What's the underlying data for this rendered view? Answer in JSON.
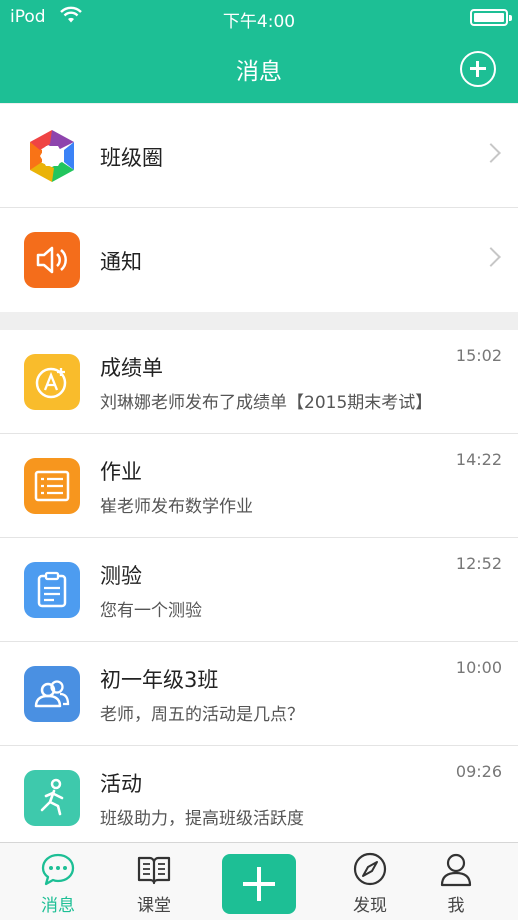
{
  "status_bar": {
    "carrier": "iPod",
    "time": "下午4:00"
  },
  "nav": {
    "title": "消息"
  },
  "pinned": [
    {
      "title": "班级圈",
      "icon": "aperture-icon"
    },
    {
      "title": "通知",
      "icon": "speaker-icon",
      "color": "#f46d1b"
    }
  ],
  "messages": [
    {
      "title": "成绩单",
      "subtitle": "刘琳娜老师发布了成绩单【2015期末考试】",
      "time": "15:02",
      "icon": "grade-icon",
      "color": "#f9bc2c"
    },
    {
      "title": "作业",
      "subtitle": "崔老师发布数学作业",
      "time": "14:22",
      "icon": "homework-icon",
      "color": "#f7961e"
    },
    {
      "title": "测验",
      "subtitle": "您有一个测验",
      "time": "12:52",
      "icon": "clipboard-icon",
      "color": "#4d9cf0"
    },
    {
      "title": "初一年级3班",
      "subtitle": "老师，周五的活动是几点？",
      "time": "10:00",
      "icon": "group-icon",
      "color": "#4a90e2"
    },
    {
      "title": "活动",
      "subtitle": "班级助力，提高班级活跃度",
      "time": "09:26",
      "icon": "running-icon",
      "color": "#3ec9ac"
    }
  ],
  "tabbar": {
    "messages_label": "消息",
    "classroom_label": "课堂",
    "discover_label": "发现",
    "me_label": "我"
  },
  "colors": {
    "accent": "#1dbf95"
  }
}
